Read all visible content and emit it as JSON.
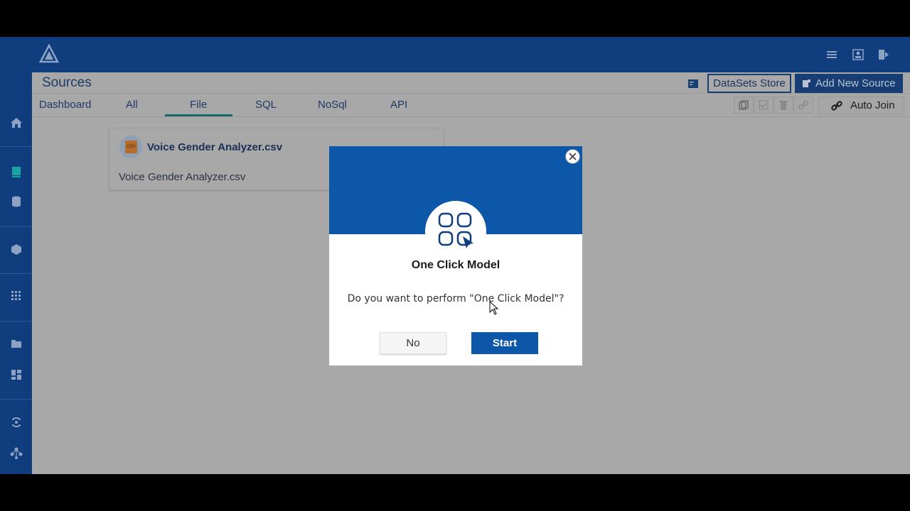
{
  "header": {
    "page_title": "Sources",
    "datasets_store_label": "DataSets Store",
    "add_source_label": "Add New Source"
  },
  "tabs": [
    {
      "label": "Dashboard"
    },
    {
      "label": "All"
    },
    {
      "label": "File",
      "active": true
    },
    {
      "label": "SQL"
    },
    {
      "label": "NoSql"
    },
    {
      "label": "API"
    }
  ],
  "toolbar": {
    "auto_join_label": "Auto Join"
  },
  "card": {
    "badge_text": "CSV",
    "title": "Voice Gender Analyzer.csv",
    "subtitle": "Voice Gender Analyzer.csv"
  },
  "modal": {
    "title": "One Click Model",
    "message": "Do you want to perform \"One Click Model\"?",
    "no_label": "No",
    "start_label": "Start"
  },
  "colors": {
    "primary": "#0d57a8",
    "nav": "#0f3d7e",
    "overlay_bg": "#a8a8a8"
  },
  "icons": {
    "top": [
      "list-icon",
      "user-icon",
      "logout-icon"
    ],
    "sidebar": [
      "home-icon",
      "book-icon",
      "database-icon",
      "cube-icon",
      "grid-icon",
      "folder-icon",
      "dashboard-icon",
      "flow-icon",
      "network-icon",
      "deploy-icon"
    ]
  }
}
